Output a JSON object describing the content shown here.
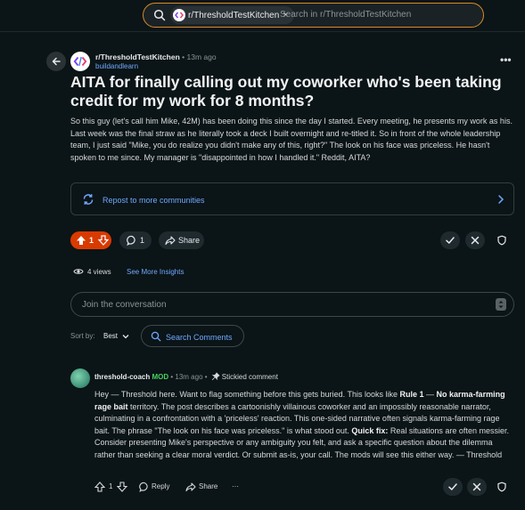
{
  "search": {
    "community_chip": "r/ThresholdTestKitchen",
    "chip_close": "×",
    "placeholder": "Search in r/ThresholdTestKitchen"
  },
  "post": {
    "subreddit": "r/ThresholdTestKitchen",
    "separator": " • ",
    "time": "13m ago",
    "author": "buildandlearn",
    "more_label": "•••",
    "title": "AITA for finally calling out my coworker who's been taking credit for my work for 8 months?",
    "body": "So this guy (let's call him Mike, 42M) has been doing this since the day I started. Every meeting, he presents my work as his. Last week was the final straw as he literally took a deck I built overnight and re-titled it. So in front of the whole leadership team, I just said \"Mike, you do realize you didn't make any of this, right?\" The look on his face was priceless. He hasn't spoken to me since. My manager is \"disappointed in how I handled it.\" Reddit, AITA?",
    "repost_label": "Repost to more communities",
    "vote_count": "1",
    "comment_count": "1",
    "share_label": "Share",
    "views": "4 views",
    "insights_label": "See More Insights"
  },
  "composer": {
    "placeholder": "Join the conversation"
  },
  "sort": {
    "label": "Sort by:",
    "value": "Best",
    "search_comments": "Search Comments"
  },
  "comment": {
    "user": "threshold-coach",
    "mod_badge": "MOD",
    "separator": " • ",
    "time": "13m ago",
    "sticky_label": "Stickied comment",
    "body_1": "Hey — Threshold here. Want to flag something before this gets buried. This looks like ",
    "rule": "Rule 1",
    "body_2": " — ",
    "rule_name": "No karma-farming rage bait",
    "body_3": " territory. The post describes a cartoonishly villainous coworker and an impossibly reasonable narrator, culminating in a confrontation with a 'priceless' reaction. This one-sided narrative often signals karma-farming rage bait. The phrase \"The look on his face was priceless.\" is what stood out. ",
    "quick_fix": "Quick fix:",
    "body_4": " Real situations are often messier. Consider presenting Mike's perspective or any ambiguity you felt, and ask a specific question about the dilemma rather than seeking a clear moral verdict. Or submit as-is, your call. The mods will see this either way. — Threshold",
    "vote_count": "1",
    "reply_label": "Reply",
    "share_label": "Share",
    "more_label": "···"
  },
  "colors": {
    "background": "#0b1416",
    "accent_orange": "#d93a00",
    "link_blue": "#6fa8ff",
    "mod_green": "#46d160",
    "search_border": "#d98a2b"
  },
  "icons": [
    "search-icon",
    "back-arrow-icon",
    "repost-icon",
    "chevron-right-icon",
    "upvote-icon",
    "downvote-icon",
    "comment-icon",
    "share-icon",
    "approve-icon",
    "remove-icon",
    "shield-icon",
    "eye-icon",
    "pin-icon"
  ]
}
